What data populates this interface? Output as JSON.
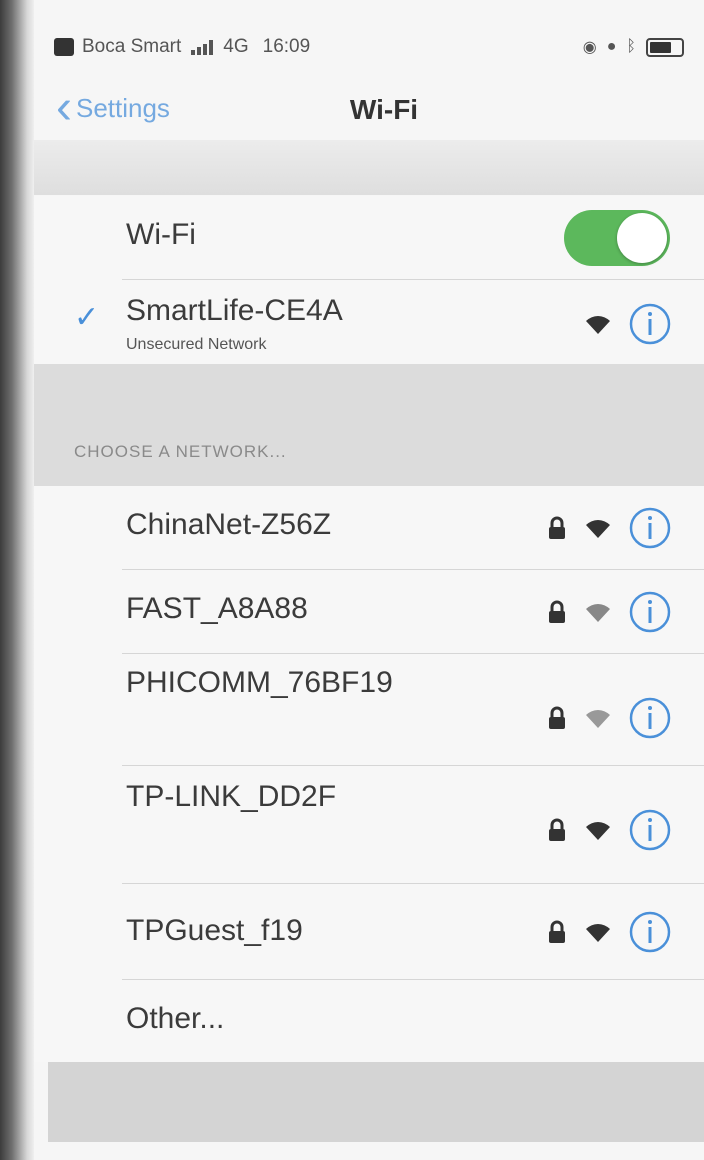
{
  "status_bar": {
    "carrier": "Boca Smart",
    "network": "4G",
    "time": "16:09"
  },
  "nav": {
    "back_label": "Settings",
    "title": "Wi-Fi"
  },
  "wifi_toggle": {
    "label": "Wi-Fi",
    "on": true
  },
  "connected": {
    "name": "SmartLife-CE4A",
    "subtitle": "Unsecured Network"
  },
  "section_header": "CHOOSE A NETWORK...",
  "networks": [
    {
      "name": "ChinaNet-Z56Z",
      "locked": true
    },
    {
      "name": "FAST_A8A88",
      "locked": true
    },
    {
      "name": "PHICOMM_76BF19",
      "locked": true
    },
    {
      "name": "TP-LINK_DD2F",
      "locked": true
    },
    {
      "name": "TPGuest_f19",
      "locked": true
    }
  ],
  "other_label": "Other...",
  "colors": {
    "accent": "#4a90d9",
    "toggle_on": "#5cb85c"
  }
}
